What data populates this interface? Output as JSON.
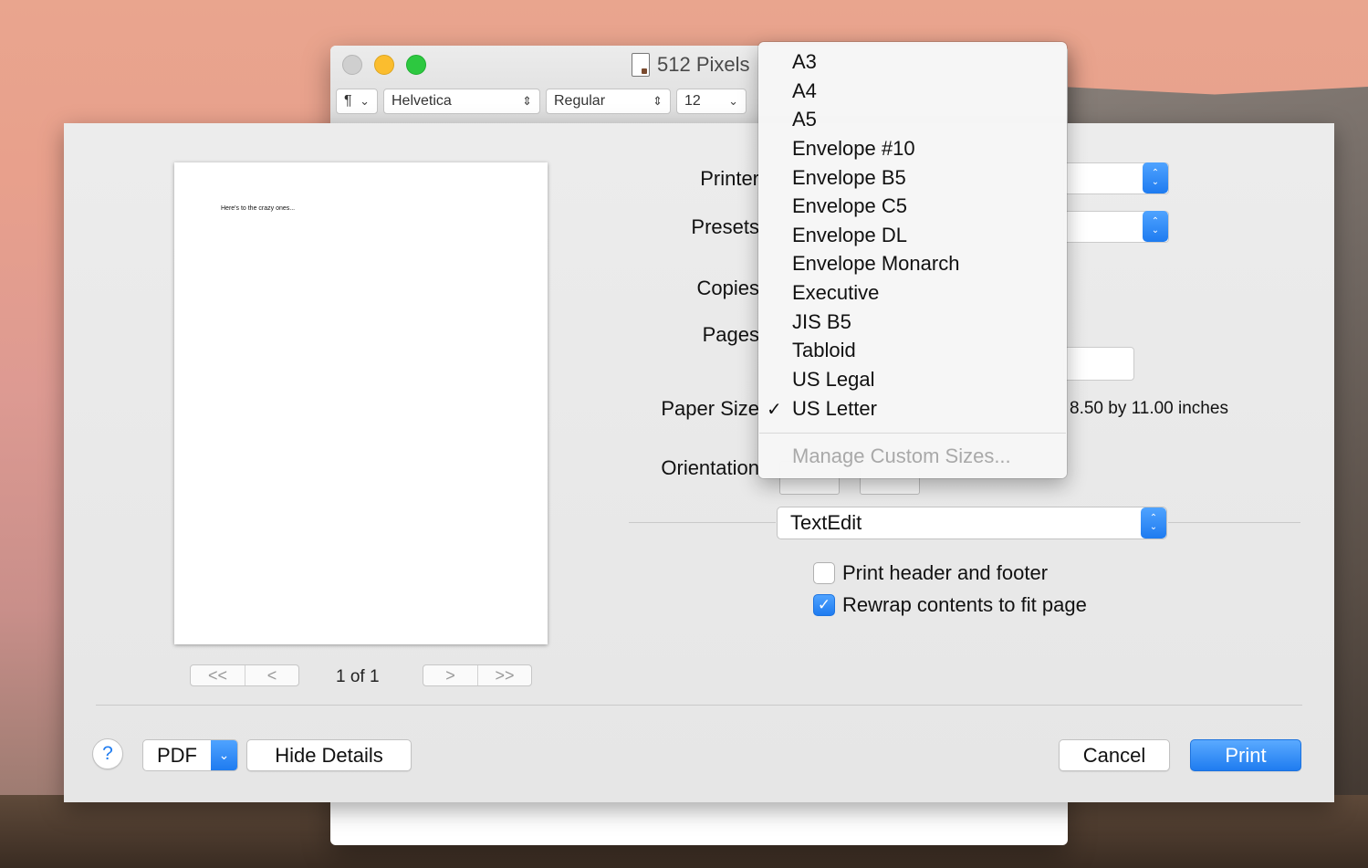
{
  "window": {
    "title": "512 Pixels",
    "toolbar": {
      "paragraph": "¶",
      "font_family": "Helvetica",
      "font_style": "Regular",
      "font_size": "12"
    }
  },
  "preview": {
    "page_text": "Here's to the crazy ones...",
    "page_count": "1 of 1",
    "nav": {
      "first": "<<",
      "prev": "<",
      "next": ">",
      "last": ">>"
    }
  },
  "settings": {
    "printer_label": "Printer",
    "presets_label": "Presets",
    "copies_label": "Copies",
    "pages_label": "Pages",
    "paper_size_label": "Paper Size",
    "paper_dims": "8.50 by 11.00 inches",
    "orientation_label": "Orientation",
    "app_section": "TextEdit",
    "print_header_footer": "Print header and footer",
    "rewrap_contents": "Rewrap contents to fit page"
  },
  "paper_menu": {
    "items": [
      "A3",
      "A4",
      "A5",
      "Envelope #10",
      "Envelope B5",
      "Envelope C5",
      "Envelope DL",
      "Envelope Monarch",
      "Executive",
      "JIS B5",
      "Tabloid",
      "US Legal",
      "US Letter"
    ],
    "selected": "US Letter",
    "check_glyph": "✓",
    "manage": "Manage Custom Sizes..."
  },
  "footer": {
    "help": "?",
    "pdf": "PDF",
    "hide_details": "Hide Details",
    "cancel": "Cancel",
    "print": "Print"
  },
  "checkbox_states": {
    "print_header_footer": false,
    "rewrap_contents": true
  },
  "colors": {
    "accent": "#1f7cf0"
  }
}
